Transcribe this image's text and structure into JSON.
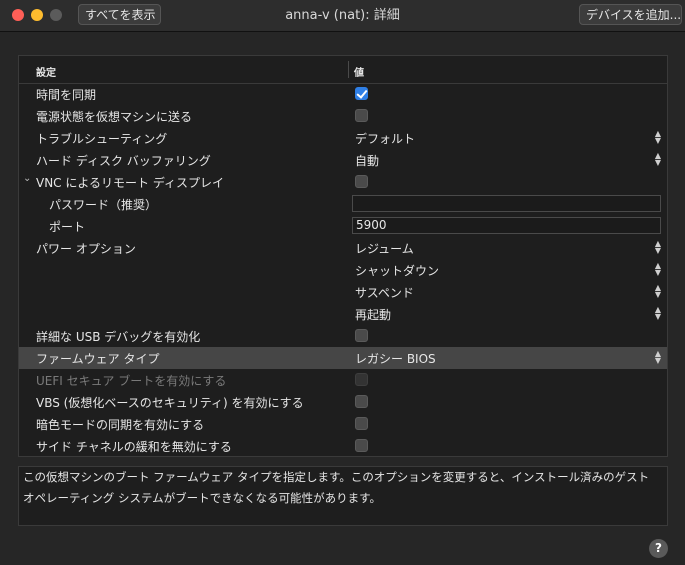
{
  "window": {
    "title": "anna-v (nat): 詳細",
    "show_all_label": "すべてを表示",
    "add_device_label": "デバイスを追加..."
  },
  "table": {
    "headers": {
      "setting": "設定",
      "value": "値"
    },
    "rows": [
      {
        "label": "時間を同期",
        "control": "checkbox",
        "checked": true
      },
      {
        "label": "電源状態を仮想マシンに送る",
        "control": "checkbox",
        "checked": false
      },
      {
        "label": "トラブルシューティング",
        "control": "select",
        "value": "デフォルト"
      },
      {
        "label": "ハード ディスク バッファリング",
        "control": "select",
        "value": "自動"
      },
      {
        "label": "VNC によるリモート ディスプレイ",
        "control": "checkbox",
        "checked": false,
        "expanded": true
      },
      {
        "label": "パスワード（推奨）",
        "control": "text",
        "value": ""
      },
      {
        "label": "ポート",
        "control": "text",
        "value": "5900"
      },
      {
        "label": "パワー オプション",
        "control": "select",
        "value": "レジューム"
      },
      {
        "label": "",
        "control": "select",
        "value": "シャットダウン"
      },
      {
        "label": "",
        "control": "select",
        "value": "サスペンド"
      },
      {
        "label": "",
        "control": "select",
        "value": "再起動"
      },
      {
        "label": "詳細な USB デバッグを有効化",
        "control": "checkbox",
        "checked": false
      },
      {
        "label": "ファームウェア タイプ",
        "control": "select",
        "value": "レガシー BIOS",
        "selected": true
      },
      {
        "label": "UEFI セキュア ブートを有効にする",
        "control": "checkbox",
        "checked": false,
        "disabled": true
      },
      {
        "label": "VBS (仮想化ベースのセキュリティ) を有効にする",
        "control": "checkbox",
        "checked": false
      },
      {
        "label": "暗色モードの同期を有効にする",
        "control": "checkbox",
        "checked": false
      },
      {
        "label": "サイド チャネルの緩和を無効にする",
        "control": "checkbox",
        "checked": false
      }
    ]
  },
  "description": "この仮想マシンのブート ファームウェア タイプを指定します。このオプションを変更すると、インストール済みのゲスト オペレーティング システムがブートできなくなる可能性があります。",
  "help_label": "?",
  "colors": {
    "accent": "#2f7fe6",
    "background": "#262626",
    "selected_row": "#464646"
  }
}
